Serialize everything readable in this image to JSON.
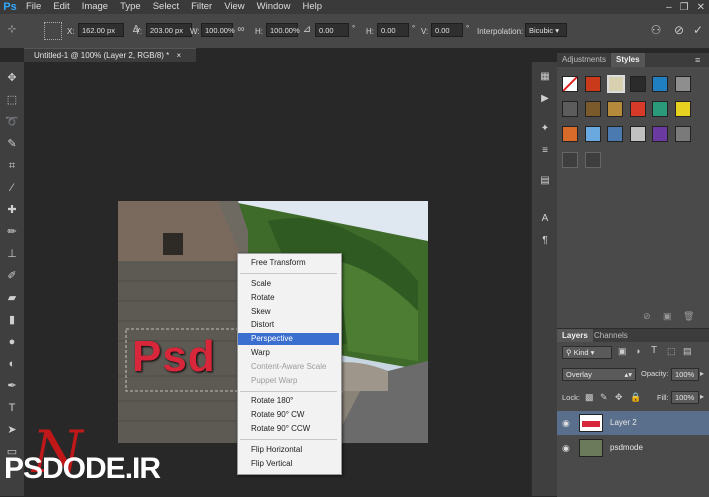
{
  "app": {
    "logo": "Ps"
  },
  "menu": [
    "File",
    "Edit",
    "Image",
    "Type",
    "Select",
    "Filter",
    "View",
    "Window",
    "Help"
  ],
  "window_controls": {
    "minimize": "–",
    "restore": "❐",
    "close": "✕"
  },
  "options": {
    "x_label": "X:",
    "x_value": "162.00 px",
    "y_label": "Y:",
    "y_value": "203.00 px",
    "w_label": "W:",
    "w_value": "100.00%",
    "h_label": "H:",
    "h_value": "100.00%",
    "angle_value": "0.00",
    "deg": "°",
    "hskew_label": "H:",
    "hskew_value": "0.00",
    "vskew_label": "V:",
    "vskew_value": "0.00",
    "interpolation_label": "Interpolation:",
    "interpolation_value": "Bicubic"
  },
  "document_tab": {
    "title": "Untitled-1 @ 100% (Layer 2, RGB/8) *",
    "close": "×"
  },
  "context_menu": {
    "items": [
      {
        "label": "Free Transform",
        "state": "normal"
      },
      {
        "label": "Scale",
        "state": "normal"
      },
      {
        "label": "Rotate",
        "state": "normal"
      },
      {
        "label": "Skew",
        "state": "normal"
      },
      {
        "label": "Distort",
        "state": "normal"
      },
      {
        "label": "Perspective",
        "state": "highlighted"
      },
      {
        "label": "Warp",
        "state": "normal"
      },
      {
        "label": "Content-Aware Scale",
        "state": "disabled"
      },
      {
        "label": "Puppet Warp",
        "state": "disabled"
      },
      {
        "label": "Rotate 180°",
        "state": "normal"
      },
      {
        "label": "Rotate 90° CW",
        "state": "normal"
      },
      {
        "label": "Rotate 90° CCW",
        "state": "normal"
      },
      {
        "label": "Flip Horizontal",
        "state": "normal"
      },
      {
        "label": "Flip Vertical",
        "state": "normal"
      }
    ]
  },
  "canvas_text": "Psd",
  "watermark": {
    "text": "PSDODE.IR",
    "accent": "N",
    "accent_color": "#c01818"
  },
  "panels": {
    "tabs": [
      "Adjustments",
      "Styles"
    ],
    "active_tab": "Styles"
  },
  "layers_panel": {
    "tabs": [
      "Layers",
      "Channels"
    ],
    "filter_kind": "Kind",
    "blend_mode": "Overlay",
    "opacity_label": "Opacity:",
    "opacity_value": "100%",
    "lock_label": "Lock:",
    "fill_label": "Fill:",
    "fill_value": "100%",
    "layers": [
      {
        "name": "Layer 2",
        "selected": true
      },
      {
        "name": "psdmode",
        "selected": false
      }
    ]
  },
  "colors": {
    "highlight": "#3a6fcf",
    "selected_layer": "#5a6f8c",
    "ps_blue": "#31a8ff"
  }
}
